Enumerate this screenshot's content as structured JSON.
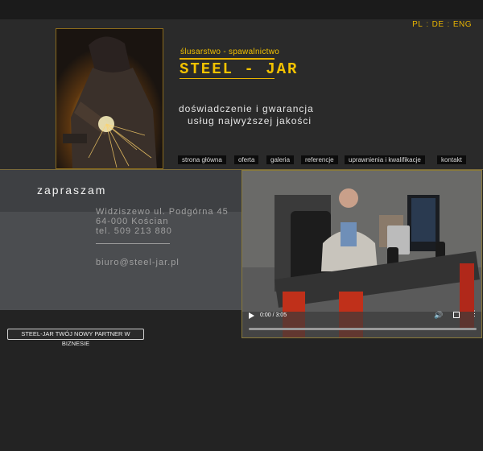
{
  "languages": [
    "PL",
    "DE",
    "ENG"
  ],
  "brand": {
    "subtitle": "ślusarstwo - spawalnictwo",
    "title": "STEEL - JAR"
  },
  "tagline": {
    "line1": "doświadczenie i gwarancja",
    "line2": "usług najwyższej jakości"
  },
  "nav": [
    {
      "label": "strona główna"
    },
    {
      "label": "oferta"
    },
    {
      "label": "galeria"
    },
    {
      "label": "referencje"
    },
    {
      "label": "uprawnienia i kwalifikacje"
    },
    {
      "label": "kontakt"
    }
  ],
  "contact": {
    "heading": "zapraszam",
    "street": "Widziszewo ul. Podgórna 45",
    "city": "64-000 Kościan",
    "phone": "tel. 509 213 880",
    "email": "biuro@steel-jar.pl"
  },
  "video": {
    "time": "0:00 / 3:05",
    "progress": 0
  },
  "partner_button": "STEEL-JAR TWÓJ NOWY PARTNER W BIZNESIE",
  "colors": {
    "accent": "#f3c200",
    "background": "#232323"
  }
}
